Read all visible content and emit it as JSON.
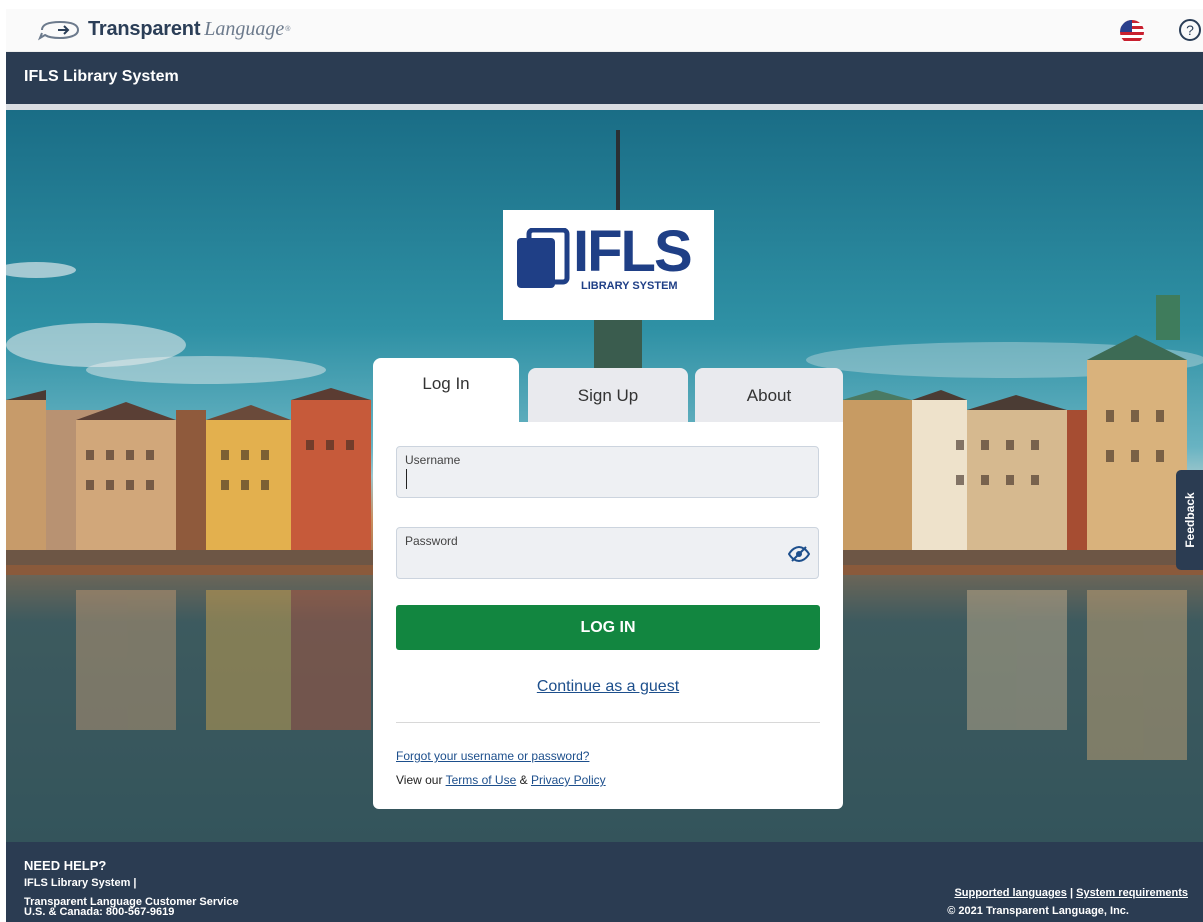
{
  "header": {
    "brand_bold": "Transparent",
    "brand_italic": "Language",
    "brand_reg": "®",
    "language_icon": "us-flag-icon",
    "help_icon": "help-circle-icon",
    "help_symbol": "?"
  },
  "system_bar": {
    "title": "IFLS Library System"
  },
  "logo": {
    "text": "IFLS",
    "subtext": "LIBRARY SYSTEM"
  },
  "tabs": [
    {
      "label": "Log In",
      "active": true
    },
    {
      "label": "Sign Up",
      "active": false
    },
    {
      "label": "About",
      "active": false
    }
  ],
  "form": {
    "username_label": "Username",
    "username_value": "",
    "password_label": "Password",
    "password_value": "",
    "password_toggle_icon": "eye-slash-icon",
    "login_button": "LOG IN",
    "guest_link": "Continue as a guest",
    "forgot_link": "Forgot your username or password?",
    "terms_prefix": "View our ",
    "terms_link": "Terms of Use",
    "terms_amp": " & ",
    "privacy_link": "Privacy Policy"
  },
  "feedback_label": "Feedback",
  "footer": {
    "need_help": "NEED HELP?",
    "line1": "IFLS Library System |",
    "line2": "Transparent Language Customer Service",
    "line3": "U.S. & Canada: 800-567-9619",
    "supported_languages": "Supported languages",
    "sep": " | ",
    "system_requirements": "System requirements",
    "copyright": "© 2021 Transparent Language, Inc."
  },
  "colors": {
    "navy": "#2b3c52",
    "login_green": "#128640",
    "link_blue": "#1d4f8c",
    "logo_blue": "#1f3f86"
  }
}
